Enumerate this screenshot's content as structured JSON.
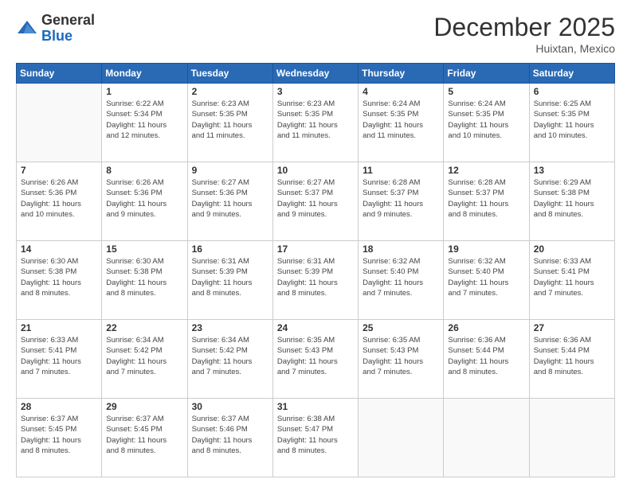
{
  "header": {
    "logo_general": "General",
    "logo_blue": "Blue",
    "month_title": "December 2025",
    "location": "Huixtan, Mexico"
  },
  "weekdays": [
    "Sunday",
    "Monday",
    "Tuesday",
    "Wednesday",
    "Thursday",
    "Friday",
    "Saturday"
  ],
  "weeks": [
    [
      {
        "day": "",
        "info": ""
      },
      {
        "day": "1",
        "info": "Sunrise: 6:22 AM\nSunset: 5:34 PM\nDaylight: 11 hours\nand 12 minutes."
      },
      {
        "day": "2",
        "info": "Sunrise: 6:23 AM\nSunset: 5:35 PM\nDaylight: 11 hours\nand 11 minutes."
      },
      {
        "day": "3",
        "info": "Sunrise: 6:23 AM\nSunset: 5:35 PM\nDaylight: 11 hours\nand 11 minutes."
      },
      {
        "day": "4",
        "info": "Sunrise: 6:24 AM\nSunset: 5:35 PM\nDaylight: 11 hours\nand 11 minutes."
      },
      {
        "day": "5",
        "info": "Sunrise: 6:24 AM\nSunset: 5:35 PM\nDaylight: 11 hours\nand 10 minutes."
      },
      {
        "day": "6",
        "info": "Sunrise: 6:25 AM\nSunset: 5:35 PM\nDaylight: 11 hours\nand 10 minutes."
      }
    ],
    [
      {
        "day": "7",
        "info": "Sunrise: 6:26 AM\nSunset: 5:36 PM\nDaylight: 11 hours\nand 10 minutes."
      },
      {
        "day": "8",
        "info": "Sunrise: 6:26 AM\nSunset: 5:36 PM\nDaylight: 11 hours\nand 9 minutes."
      },
      {
        "day": "9",
        "info": "Sunrise: 6:27 AM\nSunset: 5:36 PM\nDaylight: 11 hours\nand 9 minutes."
      },
      {
        "day": "10",
        "info": "Sunrise: 6:27 AM\nSunset: 5:37 PM\nDaylight: 11 hours\nand 9 minutes."
      },
      {
        "day": "11",
        "info": "Sunrise: 6:28 AM\nSunset: 5:37 PM\nDaylight: 11 hours\nand 9 minutes."
      },
      {
        "day": "12",
        "info": "Sunrise: 6:28 AM\nSunset: 5:37 PM\nDaylight: 11 hours\nand 8 minutes."
      },
      {
        "day": "13",
        "info": "Sunrise: 6:29 AM\nSunset: 5:38 PM\nDaylight: 11 hours\nand 8 minutes."
      }
    ],
    [
      {
        "day": "14",
        "info": "Sunrise: 6:30 AM\nSunset: 5:38 PM\nDaylight: 11 hours\nand 8 minutes."
      },
      {
        "day": "15",
        "info": "Sunrise: 6:30 AM\nSunset: 5:38 PM\nDaylight: 11 hours\nand 8 minutes."
      },
      {
        "day": "16",
        "info": "Sunrise: 6:31 AM\nSunset: 5:39 PM\nDaylight: 11 hours\nand 8 minutes."
      },
      {
        "day": "17",
        "info": "Sunrise: 6:31 AM\nSunset: 5:39 PM\nDaylight: 11 hours\nand 8 minutes."
      },
      {
        "day": "18",
        "info": "Sunrise: 6:32 AM\nSunset: 5:40 PM\nDaylight: 11 hours\nand 7 minutes."
      },
      {
        "day": "19",
        "info": "Sunrise: 6:32 AM\nSunset: 5:40 PM\nDaylight: 11 hours\nand 7 minutes."
      },
      {
        "day": "20",
        "info": "Sunrise: 6:33 AM\nSunset: 5:41 PM\nDaylight: 11 hours\nand 7 minutes."
      }
    ],
    [
      {
        "day": "21",
        "info": "Sunrise: 6:33 AM\nSunset: 5:41 PM\nDaylight: 11 hours\nand 7 minutes."
      },
      {
        "day": "22",
        "info": "Sunrise: 6:34 AM\nSunset: 5:42 PM\nDaylight: 11 hours\nand 7 minutes."
      },
      {
        "day": "23",
        "info": "Sunrise: 6:34 AM\nSunset: 5:42 PM\nDaylight: 11 hours\nand 7 minutes."
      },
      {
        "day": "24",
        "info": "Sunrise: 6:35 AM\nSunset: 5:43 PM\nDaylight: 11 hours\nand 7 minutes."
      },
      {
        "day": "25",
        "info": "Sunrise: 6:35 AM\nSunset: 5:43 PM\nDaylight: 11 hours\nand 7 minutes."
      },
      {
        "day": "26",
        "info": "Sunrise: 6:36 AM\nSunset: 5:44 PM\nDaylight: 11 hours\nand 8 minutes."
      },
      {
        "day": "27",
        "info": "Sunrise: 6:36 AM\nSunset: 5:44 PM\nDaylight: 11 hours\nand 8 minutes."
      }
    ],
    [
      {
        "day": "28",
        "info": "Sunrise: 6:37 AM\nSunset: 5:45 PM\nDaylight: 11 hours\nand 8 minutes."
      },
      {
        "day": "29",
        "info": "Sunrise: 6:37 AM\nSunset: 5:45 PM\nDaylight: 11 hours\nand 8 minutes."
      },
      {
        "day": "30",
        "info": "Sunrise: 6:37 AM\nSunset: 5:46 PM\nDaylight: 11 hours\nand 8 minutes."
      },
      {
        "day": "31",
        "info": "Sunrise: 6:38 AM\nSunset: 5:47 PM\nDaylight: 11 hours\nand 8 minutes."
      },
      {
        "day": "",
        "info": ""
      },
      {
        "day": "",
        "info": ""
      },
      {
        "day": "",
        "info": ""
      }
    ]
  ]
}
